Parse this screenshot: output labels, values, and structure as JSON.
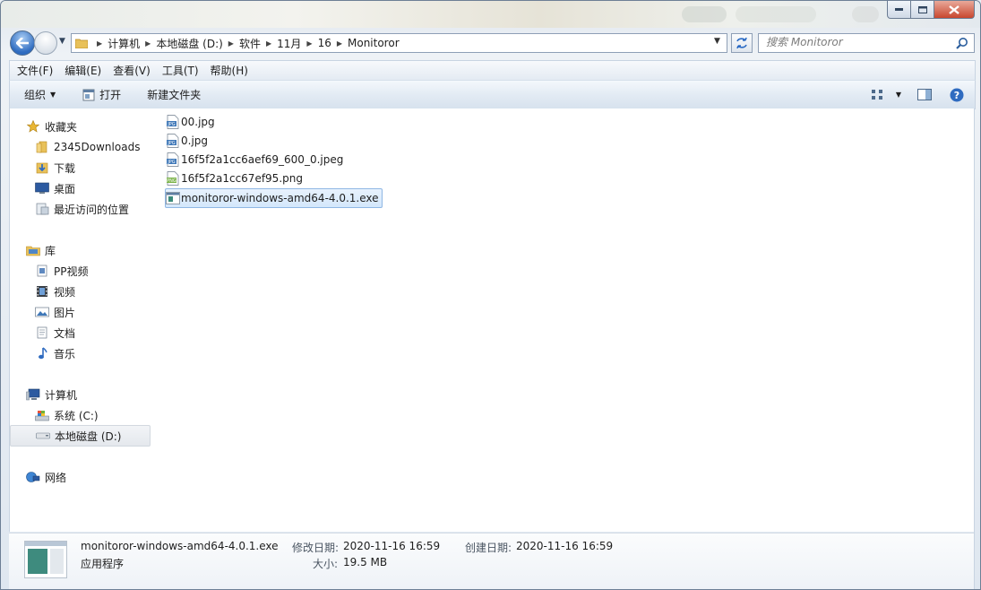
{
  "window": {
    "caption_buttons": {
      "minimize": "minimize",
      "maximize": "maximize",
      "close": "close"
    }
  },
  "address": {
    "crumbs": [
      "计算机",
      "本地磁盘 (D:)",
      "软件",
      "11月",
      "16",
      "Monitoror"
    ]
  },
  "search": {
    "placeholder": "搜索 Monitoror"
  },
  "menu": [
    "文件(F)",
    "编辑(E)",
    "查看(V)",
    "工具(T)",
    "帮助(H)"
  ],
  "toolbar": {
    "organize": "组织",
    "open": "打开",
    "new_folder": "新建文件夹"
  },
  "sidebar": {
    "favorites": {
      "label": "收藏夹",
      "items": [
        "2345Downloads",
        "下载",
        "桌面",
        "最近访问的位置"
      ]
    },
    "libraries": {
      "label": "库",
      "items": [
        "PP视频",
        "视频",
        "图片",
        "文档",
        "音乐"
      ]
    },
    "computer": {
      "label": "计算机",
      "items": [
        "系统 (C:)",
        "本地磁盘 (D:)"
      ]
    },
    "network": {
      "label": "网络"
    }
  },
  "files": [
    {
      "name": "00.jpg",
      "icon": "jpg-file-icon"
    },
    {
      "name": "0.jpg",
      "icon": "jpg-file-icon"
    },
    {
      "name": "16f5f2a1cc6aef69_600_0.jpeg",
      "icon": "jpg-file-icon"
    },
    {
      "name": "16f5f2a1cc67ef95.png",
      "icon": "png-file-icon"
    },
    {
      "name": "monitoror-windows-amd64-4.0.1.exe",
      "icon": "exe-file-icon",
      "selected": true
    }
  ],
  "details": {
    "name": "monitoror-windows-amd64-4.0.1.exe",
    "type": "应用程序",
    "modified_label": "修改日期:",
    "modified_value": "2020-11-16 16:59",
    "size_label": "大小:",
    "size_value": "19.5 MB",
    "created_label": "创建日期:",
    "created_value": "2020-11-16 16:59"
  },
  "colors": {
    "selection": "#d4e7fb",
    "selection_border": "#8fb7e4",
    "window_border": "#6d7f95"
  }
}
